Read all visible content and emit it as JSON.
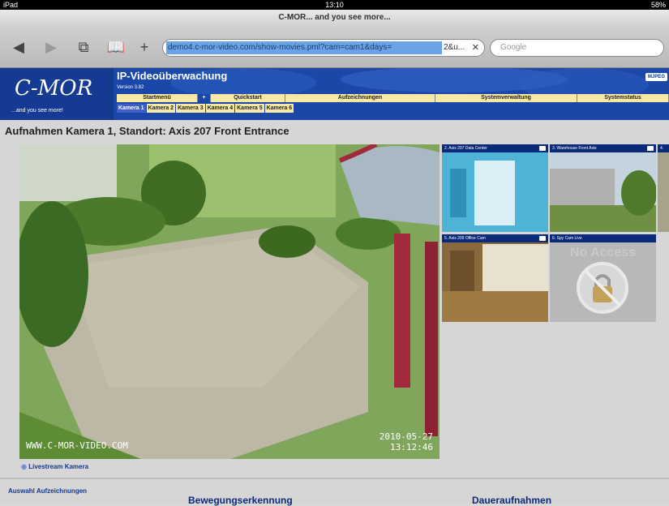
{
  "status": {
    "device": "iPad",
    "time": "13:10",
    "battery": "58%"
  },
  "browser": {
    "page_title": "C-MOR... and you see more...",
    "url_selected": "demo4.c-mor-video.com/show-movies.pml?cam=cam1&days=",
    "url_rest": "2&u...",
    "search_placeholder": "Google"
  },
  "app": {
    "logo": "C-MOR",
    "tagline": "...and you see more!",
    "title": "IP-Videoüberwachung",
    "version": "Version 3.82",
    "mjpeg": "MJPEG",
    "menu": [
      "Startmenü",
      "+",
      "Quickstart",
      "Aufzeichnungen",
      "Systemverwaltung",
      "Systemstatus"
    ],
    "cameras": [
      "Kamera 1",
      "Kamera 2",
      "Kamera 3",
      "Kamera 4",
      "Kamera 5",
      "Kamera 6"
    ]
  },
  "main": {
    "heading": "Aufnahmen Kamera 1, Standort: Axis 207 Front Entrance",
    "overlay_url": "WWW.C-MOR-VIDEO.COM",
    "overlay_date": "2010-05-27",
    "overlay_time": "13:12:46",
    "livestream": "Livestream Kamera"
  },
  "thumbs": [
    {
      "caption": "2. Axis 207 Data Center"
    },
    {
      "caption": "3. Warehouse Front Axis"
    },
    {
      "caption": "4."
    },
    {
      "caption": "5. Axis 209 Office Cam"
    },
    {
      "caption": "6. Spy Cam Live",
      "overlay": "No Access"
    }
  ],
  "footer": {
    "recordings_label": "Auswahl Aufzeichnungen",
    "motion": "Bewegungserkennung",
    "continuous": "Daueraufnahmen"
  }
}
